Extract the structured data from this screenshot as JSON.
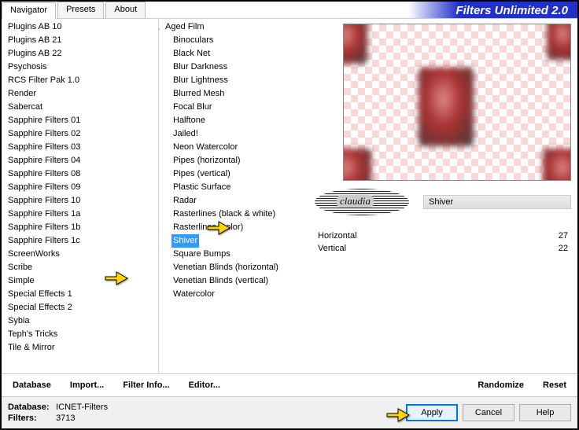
{
  "brand": "Filters Unlimited 2.0",
  "tabs": [
    "Navigator",
    "Presets",
    "About"
  ],
  "active_tab": 0,
  "categories": [
    "Plugins AB 10",
    "Plugins AB 21",
    "Plugins AB 22",
    "Psychosis",
    "RCS Filter Pak 1.0",
    "Render",
    "Sabercat",
    "Sapphire Filters 01",
    "Sapphire Filters 02",
    "Sapphire Filters 03",
    "Sapphire Filters 04",
    "Sapphire Filters 08",
    "Sapphire Filters 09",
    "Sapphire Filters 10",
    "Sapphire Filters 1a",
    "Sapphire Filters 1b",
    "Sapphire Filters 1c",
    "ScreenWorks",
    "Scribe",
    "Simple",
    "Special Effects 1",
    "Special Effects 2",
    "Sybia",
    "Teph's Tricks",
    "Tile & Mirror"
  ],
  "filters_branch": "Aged Film",
  "filters": [
    "Binoculars",
    "Black Net",
    "Blur Darkness",
    "Blur Lightness",
    "Blurred Mesh",
    "Focal Blur",
    "Halftone",
    "Jailed!",
    "Neon Watercolor",
    "Pipes (horizontal)",
    "Pipes (vertical)",
    "Plastic Surface",
    "Radar",
    "Rasterlines (black & white)",
    "Rasterlines (color)",
    "Shiver",
    "Square Bumps",
    "Venetian Blinds (horizontal)",
    "Venetian Blinds (vertical)",
    "Watercolor"
  ],
  "selected_filter_index": 15,
  "current_filter": "Shiver",
  "params": [
    {
      "name": "Horizontal",
      "value": 27
    },
    {
      "name": "Vertical",
      "value": 22
    }
  ],
  "toolbar": {
    "database": "Database",
    "import": "Import...",
    "filter_info": "Filter Info...",
    "editor": "Editor...",
    "randomize": "Randomize",
    "reset": "Reset"
  },
  "footer": {
    "db_label": "Database:",
    "db_value": "ICNET-Filters",
    "filters_label": "Filters:",
    "filters_value": "3713",
    "apply": "Apply",
    "cancel": "Cancel",
    "help": "Help"
  }
}
